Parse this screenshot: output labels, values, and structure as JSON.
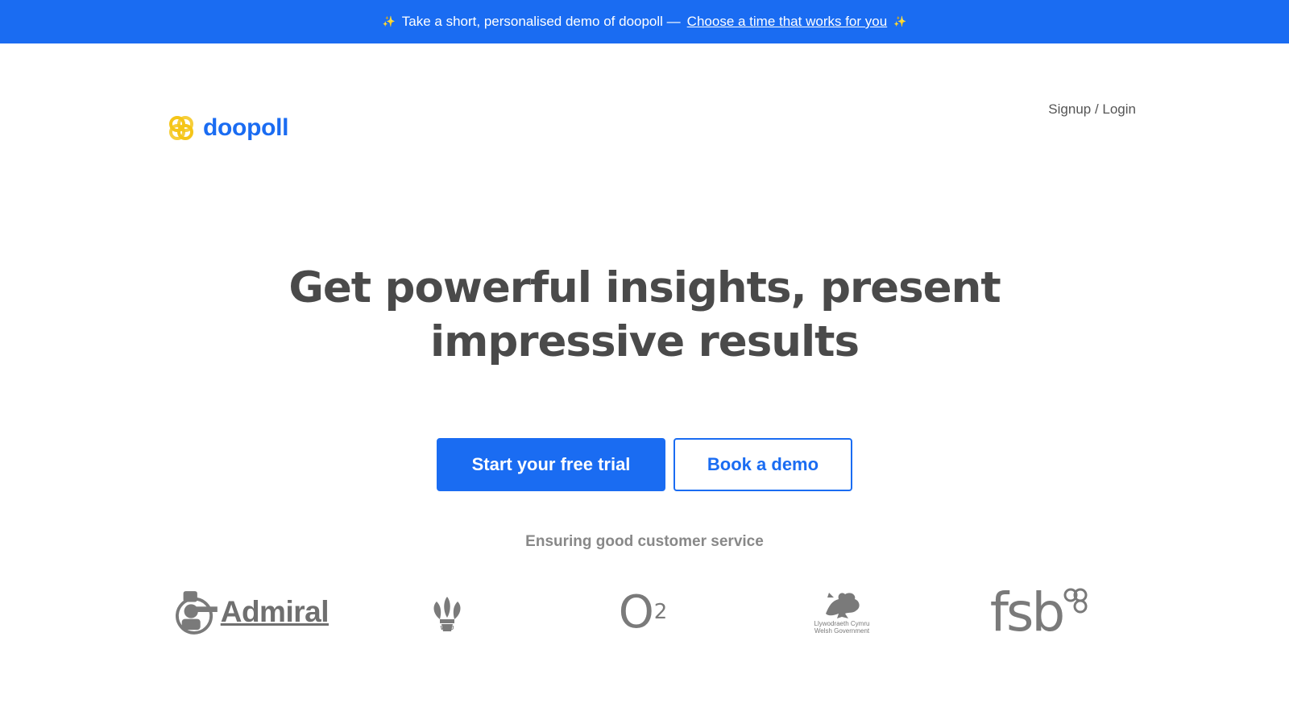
{
  "banner": {
    "text": "Take a short, personalised demo of doopoll —",
    "link_label": "Choose a time that works for you",
    "icon_left": "sparkle-icon",
    "icon_right": "sparkle-icon",
    "background": "#1a6cf2"
  },
  "header": {
    "brand": "doopoll",
    "brand_icon": "doopoll-logo-icon",
    "signup_login": "Signup / Login"
  },
  "hero": {
    "headline_line1": "Get powerful insights, present",
    "headline_line2": "impressive results",
    "primary_cta": "Start your free trial",
    "secondary_cta": "Book a demo",
    "tagline": "Ensuring good customer service"
  },
  "clients": {
    "admiral": "Admiral",
    "wru": "WRU",
    "o2_letter": "O",
    "o2_sub": "2",
    "welsh_line1": "Llywodraeth Cymru",
    "welsh_line2": "Welsh Government",
    "fsb": "fsb"
  },
  "colors": {
    "accent": "#1a6cf2",
    "logo_yellow": "#f5c518",
    "headline": "#4a4a4a",
    "muted": "#888888"
  }
}
